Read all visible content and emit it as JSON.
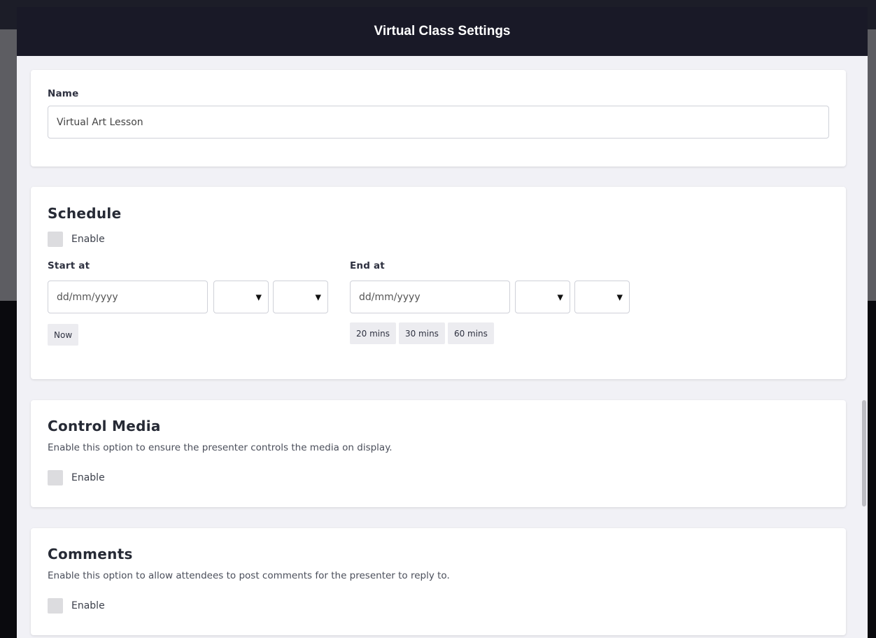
{
  "modal": {
    "title": "Virtual Class Settings"
  },
  "name_card": {
    "label": "Name",
    "value": "Virtual Art Lesson"
  },
  "schedule": {
    "title": "Schedule",
    "enable_label": "Enable",
    "enabled": false,
    "start": {
      "label": "Start at",
      "date_placeholder": "dd/mm/yyyy",
      "quick_buttons": [
        "Now"
      ]
    },
    "end": {
      "label": "End at",
      "date_placeholder": "dd/mm/yyyy",
      "quick_buttons": [
        "20 mins",
        "30 mins",
        "60 mins"
      ]
    }
  },
  "control_media": {
    "title": "Control Media",
    "description": "Enable this option to ensure the presenter controls the media on display.",
    "enable_label": "Enable",
    "enabled": false
  },
  "comments": {
    "title": "Comments",
    "description": "Enable this option to allow attendees to post comments for the presenter to reply to.",
    "enable_label": "Enable",
    "enabled": false
  },
  "colors": {
    "header_bg": "#191927",
    "modal_bg": "#f1f1f6",
    "card_bg": "#ffffff",
    "checkbox": "#dcdcdf",
    "pill_bg": "#ececf0"
  },
  "icons": {
    "select_arrow": "caret-down-icon"
  }
}
